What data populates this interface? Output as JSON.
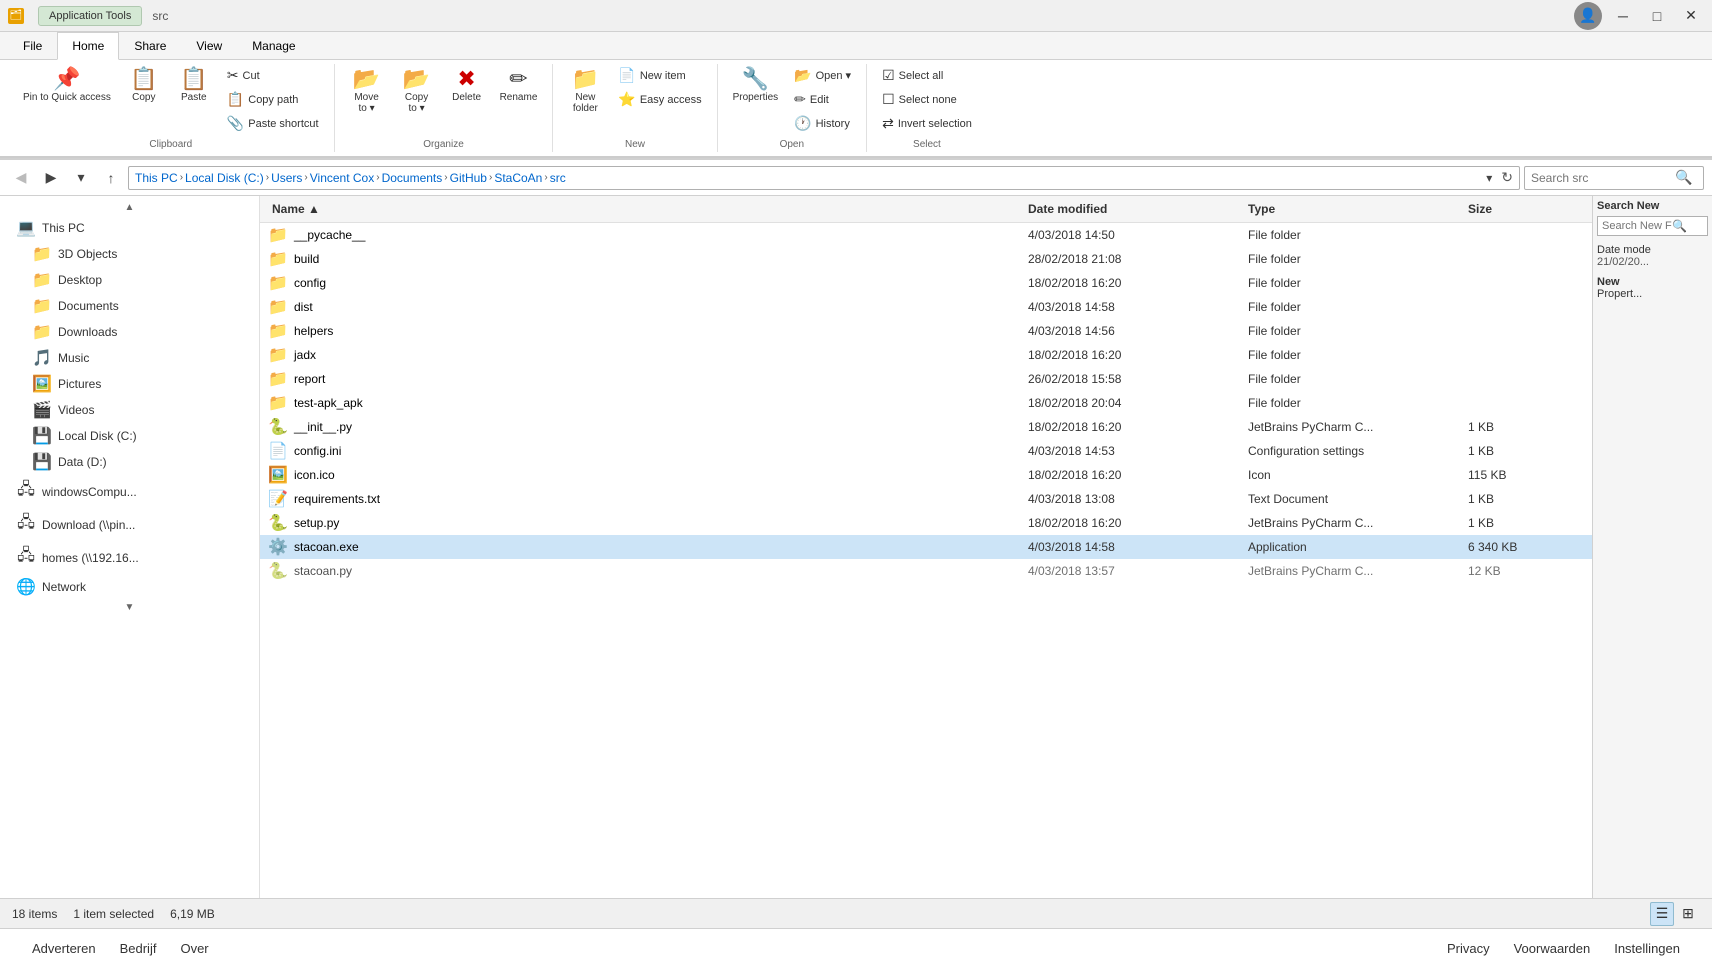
{
  "window": {
    "title": "src",
    "app_tools_label": "Application Tools",
    "tab_src": "src"
  },
  "title_bar": {
    "controls": {
      "minimize": "─",
      "maximize": "□",
      "close": "✕"
    }
  },
  "ribbon": {
    "tabs": [
      {
        "label": "File",
        "active": false
      },
      {
        "label": "Home",
        "active": true
      },
      {
        "label": "Share",
        "active": false
      },
      {
        "label": "View",
        "active": false
      },
      {
        "label": "Manage",
        "active": false
      }
    ],
    "groups": {
      "clipboard": {
        "label": "Clipboard",
        "pin_label": "Pin to Quick\naccess",
        "copy_label": "Copy",
        "paste_label": "Paste",
        "cut_label": "Cut",
        "copy_path_label": "Copy path",
        "paste_shortcut_label": "Paste shortcut"
      },
      "organize": {
        "label": "Organize",
        "move_to_label": "Move\nto",
        "copy_to_label": "Copy\nto",
        "delete_label": "Delete",
        "rename_label": "Rename"
      },
      "new": {
        "label": "New",
        "new_folder_label": "New\nfolder",
        "new_item_label": "New item",
        "easy_access_label": "Easy access"
      },
      "open": {
        "label": "Open",
        "open_label": "Open",
        "edit_label": "Edit",
        "history_label": "History",
        "properties_label": "Properties"
      },
      "select": {
        "label": "Select",
        "select_all_label": "Select all",
        "select_none_label": "Select none",
        "invert_label": "Invert selection"
      }
    }
  },
  "address_bar": {
    "breadcrumbs": [
      {
        "label": "This PC"
      },
      {
        "label": "Local Disk (C:)"
      },
      {
        "label": "Users"
      },
      {
        "label": "Vincent Cox"
      },
      {
        "label": "Documents"
      },
      {
        "label": "GitHub"
      },
      {
        "label": "StaCoAn"
      },
      {
        "label": "src"
      }
    ],
    "search_placeholder": "Search src"
  },
  "sidebar": {
    "items": [
      {
        "label": "This PC",
        "icon": "💻",
        "type": "drive"
      },
      {
        "label": "3D Objects",
        "icon": "📁",
        "type": "folder"
      },
      {
        "label": "Desktop",
        "icon": "📁",
        "type": "folder"
      },
      {
        "label": "Documents",
        "icon": "📁",
        "type": "folder"
      },
      {
        "label": "Downloads",
        "icon": "📁",
        "type": "folder"
      },
      {
        "label": "Music",
        "icon": "🎵",
        "type": "folder"
      },
      {
        "label": "Pictures",
        "icon": "🖼️",
        "type": "folder"
      },
      {
        "label": "Videos",
        "icon": "🎬",
        "type": "folder"
      },
      {
        "label": "Local Disk (C:)",
        "icon": "💾",
        "type": "drive",
        "selected": true
      },
      {
        "label": "Data (D:)",
        "icon": "💾",
        "type": "drive"
      },
      {
        "label": "windowsCompu...",
        "icon": "🖧",
        "type": "network"
      },
      {
        "label": "Download (\\\\pin...",
        "icon": "🖧",
        "type": "network"
      },
      {
        "label": "homes (\\\\192.16...",
        "icon": "🖧",
        "type": "network"
      },
      {
        "label": "Network",
        "icon": "🌐",
        "type": "network"
      }
    ]
  },
  "file_list": {
    "columns": [
      "Name",
      "Date modified",
      "Type",
      "Size"
    ],
    "files": [
      {
        "name": "__pycache__",
        "date": "4/03/2018 14:50",
        "type": "File folder",
        "size": "",
        "icon": "📁",
        "selected": false
      },
      {
        "name": "build",
        "date": "28/02/2018 21:08",
        "type": "File folder",
        "size": "",
        "icon": "📁",
        "selected": false
      },
      {
        "name": "config",
        "date": "18/02/2018 16:20",
        "type": "File folder",
        "size": "",
        "icon": "📁",
        "selected": false
      },
      {
        "name": "dist",
        "date": "4/03/2018 14:58",
        "type": "File folder",
        "size": "",
        "icon": "📁",
        "selected": false
      },
      {
        "name": "helpers",
        "date": "4/03/2018 14:56",
        "type": "File folder",
        "size": "",
        "icon": "📁",
        "selected": false
      },
      {
        "name": "jadx",
        "date": "18/02/2018 16:20",
        "type": "File folder",
        "size": "",
        "icon": "📁",
        "selected": false
      },
      {
        "name": "report",
        "date": "26/02/2018 15:58",
        "type": "File folder",
        "size": "",
        "icon": "📁",
        "selected": false
      },
      {
        "name": "test-apk_apk",
        "date": "18/02/2018 20:04",
        "type": "File folder",
        "size": "",
        "icon": "📁",
        "selected": false
      },
      {
        "name": "__init__.py",
        "date": "18/02/2018 16:20",
        "type": "JetBrains PyCharm C...",
        "size": "1 KB",
        "icon": "🐍",
        "selected": false
      },
      {
        "name": "config.ini",
        "date": "4/03/2018 14:53",
        "type": "Configuration settings",
        "size": "1 KB",
        "icon": "📄",
        "selected": false
      },
      {
        "name": "icon.ico",
        "date": "18/02/2018 16:20",
        "type": "Icon",
        "size": "115 KB",
        "icon": "🖼️",
        "selected": false
      },
      {
        "name": "requirements.txt",
        "date": "4/03/2018 13:08",
        "type": "Text Document",
        "size": "1 KB",
        "icon": "📝",
        "selected": false
      },
      {
        "name": "setup.py",
        "date": "18/02/2018 16:20",
        "type": "JetBrains PyCharm C...",
        "size": "1 KB",
        "icon": "🐍",
        "selected": false
      },
      {
        "name": "stacoan.exe",
        "date": "4/03/2018 14:58",
        "type": "Application",
        "size": "6 340 KB",
        "icon": "⚙️",
        "selected": true
      },
      {
        "name": "stacoan.py",
        "date": "4/03/2018 13:57",
        "type": "JetBrains PyCharm C...",
        "size": "12 KB",
        "icon": "🐍",
        "selected": false
      }
    ]
  },
  "status_bar": {
    "item_count": "18 items",
    "selection": "1 item selected",
    "size": "6,19 MB"
  },
  "footer": {
    "links": [
      "Adverteren",
      "Bedrijf",
      "Over",
      "Privacy",
      "Voorwaarden",
      "Instellingen"
    ]
  },
  "right_panel": {
    "search_label": "Search New",
    "search_placeholder": "Search New Fo...",
    "date_label": "Date mode",
    "date_value": "21/02/20...",
    "new_label": "New",
    "properties_label": "Propert..."
  }
}
